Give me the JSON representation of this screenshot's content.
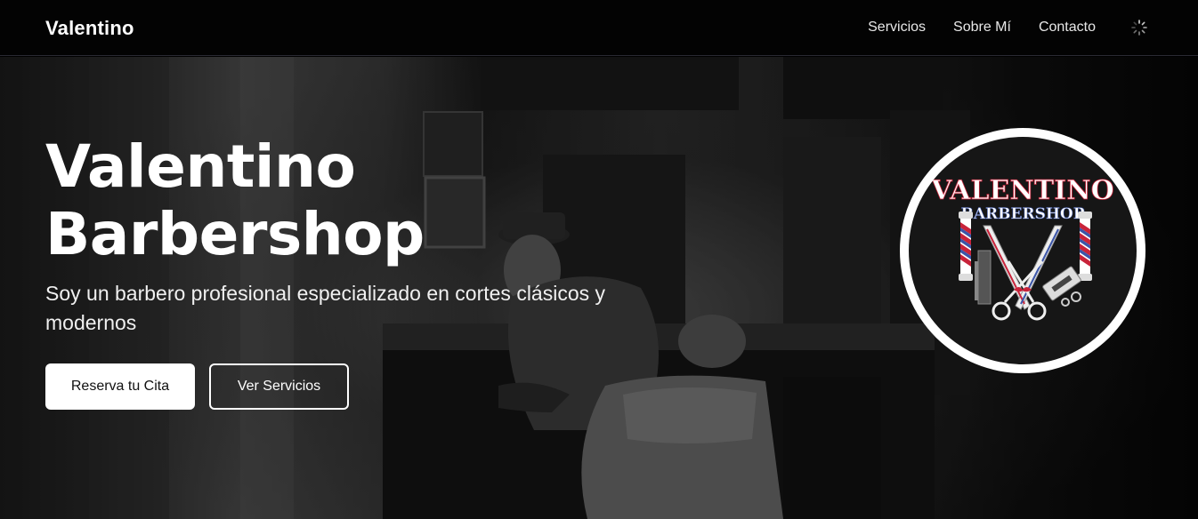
{
  "nav": {
    "brand": "Valentino",
    "links": [
      "Servicios",
      "Sobre Mí",
      "Contacto"
    ],
    "loading_icon": "spinner-icon"
  },
  "hero": {
    "title_line1": "Valentino",
    "title_line2": "Barbershop",
    "subtitle": "Soy un barbero profesional especializado en cortes clásicos y modernos",
    "primary_button": "Reserva tu Cita",
    "secondary_button": "Ver Servicios",
    "background": "barber-at-work-photo"
  },
  "logo": {
    "name": "VALENTINO",
    "tagline": "BARBERSHOP",
    "icons": [
      "barber-pole-icon",
      "scissors-icon",
      "razor-icon",
      "comb-icon"
    ],
    "colors": {
      "red": "#c8233a",
      "blue": "#3b55a8",
      "white": "#ffffff"
    }
  }
}
